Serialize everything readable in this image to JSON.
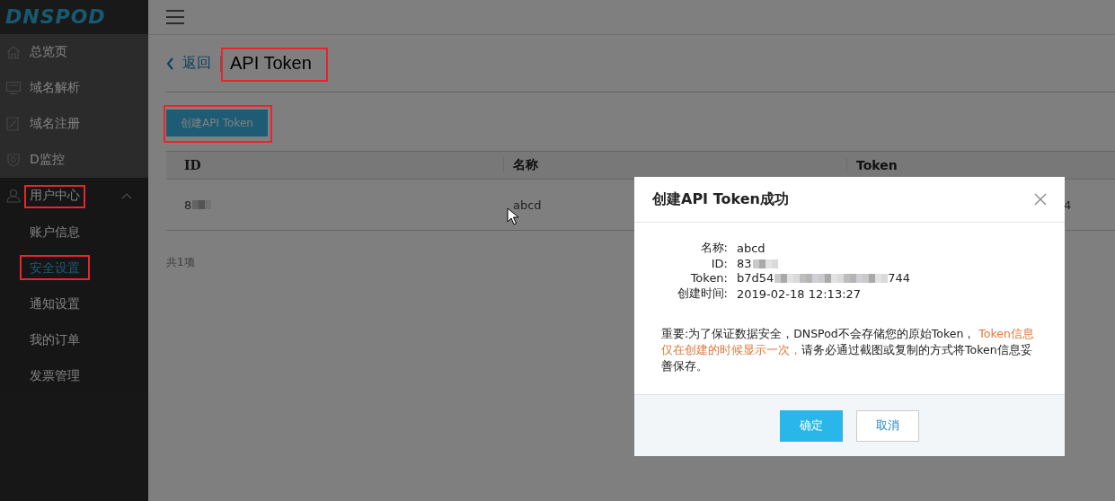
{
  "logo": "DNSPOD",
  "sidebar": {
    "items": [
      {
        "label": "总览页"
      },
      {
        "label": "域名解析"
      },
      {
        "label": "域名注册"
      },
      {
        "label": "D监控"
      },
      {
        "label": "用户中心",
        "expanded": true,
        "highlighted": true,
        "children": [
          {
            "label": "账户信息",
            "selected": false,
            "highlighted": false
          },
          {
            "label": "安全设置",
            "selected": true,
            "highlighted": true
          },
          {
            "label": "通知设置",
            "selected": false,
            "highlighted": false
          },
          {
            "label": "我的订单",
            "selected": false,
            "highlighted": false
          },
          {
            "label": "发票管理",
            "selected": false,
            "highlighted": false
          }
        ]
      }
    ]
  },
  "page": {
    "back_link": "返回",
    "title": "API Token",
    "title_highlighted": true,
    "create_button": {
      "label": "创建API Token",
      "highlighted": true
    },
    "table": {
      "columns": [
        "ID",
        "名称",
        "Token"
      ],
      "rows": [
        {
          "cells": [
            {
              "text": "8",
              "redacted": true
            },
            {
              "text": "abcd"
            },
            {
              "text": "4"
            }
          ]
        }
      ]
    },
    "total": "共1项"
  },
  "dialog": {
    "title": "创建API Token成功",
    "fields": [
      {
        "label": "名称:",
        "value": "abcd"
      },
      {
        "label": "ID:",
        "value": "83",
        "redacted": true
      },
      {
        "label": "Token:",
        "value": "b7d54",
        "redacted": true,
        "tail": "744"
      },
      {
        "label": "创建时间:",
        "value": "2019-02-18 12:13:27"
      }
    ],
    "notice": [
      {
        "text": "重要:为了保证数据安全，DNSPod不会存储您的原始Token， ",
        "kind": "normal"
      },
      {
        "text": "Token信息仅在创建的时候显示一次，",
        "kind": "warning"
      },
      {
        "text": "请务必通过截图或复制的方式将Token信息妥善保存。",
        "kind": "normal"
      }
    ],
    "buttons": [
      {
        "label": "确定",
        "kind": "primary"
      },
      {
        "label": "取消",
        "kind": "secondary"
      }
    ]
  }
}
